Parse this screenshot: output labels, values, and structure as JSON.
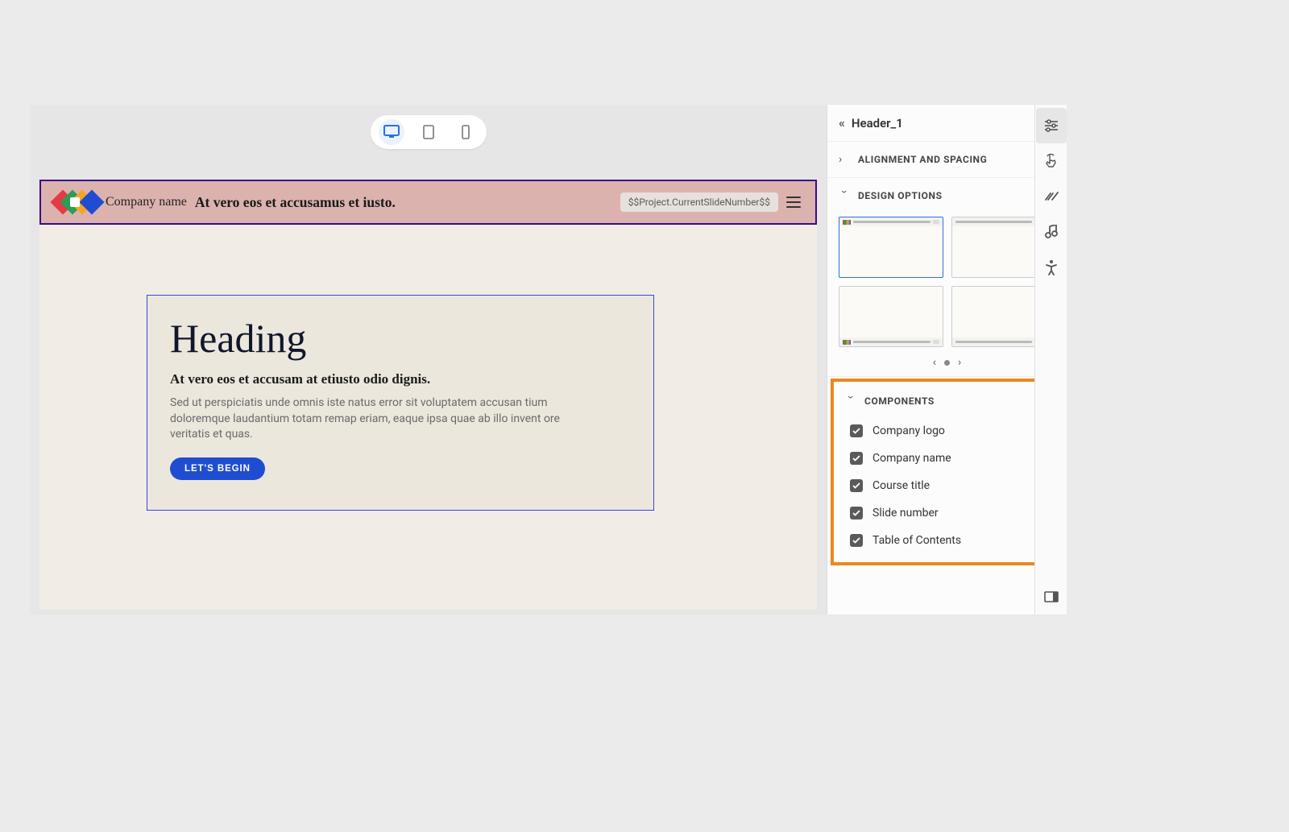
{
  "deviceSwitcher": {
    "active": "desktop"
  },
  "slide": {
    "header": {
      "companyName": "Company name",
      "courseTitle": "At vero eos et accusamus et iusto.",
      "slideNumberVar": "$$Project.CurrentSlideNumber$$"
    },
    "content": {
      "heading": "Heading",
      "subheading": "At vero eos et accusam at etiusto odio dignis.",
      "body": "Sed ut perspiciatis unde omnis iste natus error sit voluptatem accusan tium doloremque laudantium totam remap eriam, eaque ipsa quae ab illo invent ore veritatis et quas.",
      "ctaLabel": "LET'S BEGIN"
    }
  },
  "panel": {
    "title": "Header_1",
    "sections": {
      "alignment": {
        "label": "ALIGNMENT AND SPACING",
        "expanded": false
      },
      "design": {
        "label": "DESIGN OPTIONS",
        "expanded": true
      },
      "components": {
        "label": "COMPONENTS",
        "expanded": true
      }
    },
    "components": {
      "items": [
        {
          "label": "Company logo",
          "checked": true
        },
        {
          "label": "Company name",
          "checked": true
        },
        {
          "label": "Course title",
          "checked": true
        },
        {
          "label": "Slide number",
          "checked": true
        },
        {
          "label": "Table of Contents",
          "checked": true
        }
      ]
    }
  }
}
